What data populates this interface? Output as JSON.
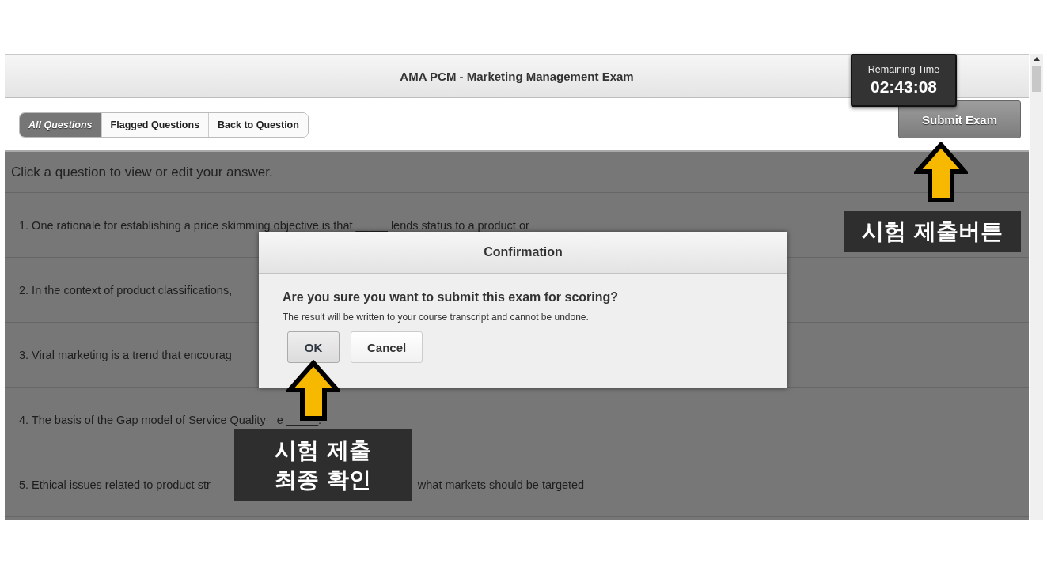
{
  "window": {
    "title": "AMA PCM - Marketing Management Exam"
  },
  "timer": {
    "label": "Remaining Time",
    "value": "02:43:08"
  },
  "tabs": [
    {
      "label": "All Questions",
      "selected": true
    },
    {
      "label": "Flagged Questions",
      "selected": false
    },
    {
      "label": "Back to Question",
      "selected": false
    }
  ],
  "submit_button": {
    "label": "Submit Exam"
  },
  "instruction": "Click a question to view or edit your answer.",
  "questions": [
    {
      "text": "1. One rationale for establishing a price skimming objective is that _____ lends status to a product or"
    },
    {
      "text": "2. In the context of product classifications,"
    },
    {
      "text": "3. Viral marketing is a trend that encourag"
    },
    {
      "text": "4. The basis of the Gap model of Service Quality",
      "text_after": "e _____."
    },
    {
      "text": "5. Ethical issues related to product str",
      "text_after": "what markets should be targeted"
    }
  ],
  "dialog": {
    "title": "Confirmation",
    "message": "Are you sure you want to submit this exam for scoring?",
    "note": "The result will be written to your course transcript and cannot be undone.",
    "buttons": [
      {
        "label": "OK",
        "focused": true
      },
      {
        "label": "Cancel",
        "focused": false
      }
    ]
  },
  "submit_callout": {
    "lines": [
      "시험 제출버튼"
    ]
  },
  "ok_callout": {
    "lines": [
      "시험 제출",
      "최종 확인"
    ]
  }
}
